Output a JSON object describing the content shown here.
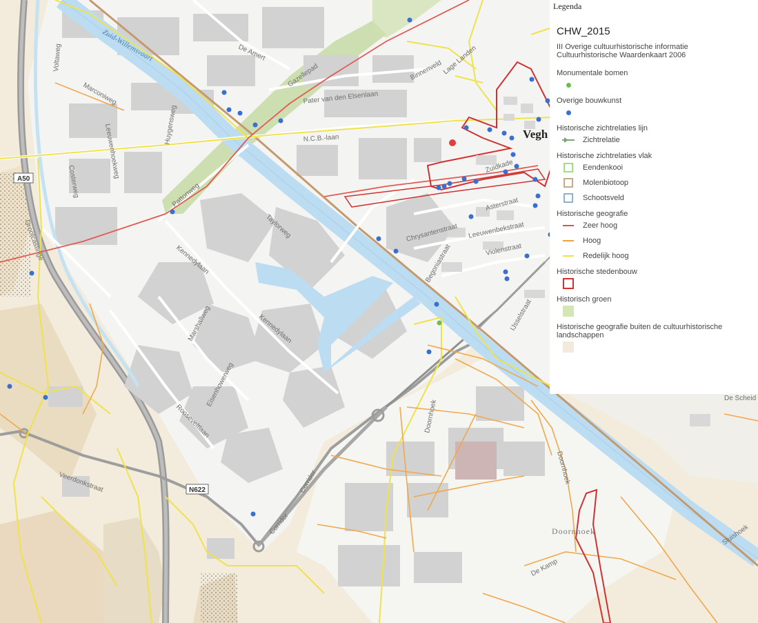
{
  "map": {
    "streets": [
      {
        "name": "Zuid-Willemsvaart",
        "kind": "canal"
      },
      {
        "name": "De Amert"
      },
      {
        "name": "Gazellepad"
      },
      {
        "name": "Pater van den Elsenlaan"
      },
      {
        "name": "Binnenveld"
      },
      {
        "name": "Lage Landen"
      },
      {
        "name": "N.C.B.-laan"
      },
      {
        "name": "Voltaweg"
      },
      {
        "name": "Marconiweg"
      },
      {
        "name": "Huygensweg"
      },
      {
        "name": "Leeuwenhoekweg"
      },
      {
        "name": "Costerweg"
      },
      {
        "name": "Pattonweg"
      },
      {
        "name": "Taylorweg"
      },
      {
        "name": "Kennedylaan"
      },
      {
        "name": "Kennedylaan"
      },
      {
        "name": "Marshallweg"
      },
      {
        "name": "Eisenhowerweg"
      },
      {
        "name": "Rooseveltlaan"
      },
      {
        "name": "Grootcastinge"
      },
      {
        "name": "Veerdonkstraat"
      },
      {
        "name": "Corridor"
      },
      {
        "name": "Corridor"
      },
      {
        "name": "Doornhoek"
      },
      {
        "name": "Chrysantenstraat"
      },
      {
        "name": "Leeuwenbekstraat"
      },
      {
        "name": "Asterstraat"
      },
      {
        "name": "Violenstraat"
      },
      {
        "name": "Begoniastraat"
      },
      {
        "name": "Zuidkade"
      },
      {
        "name": "IJsselstraat"
      },
      {
        "name": "De Scheid"
      },
      {
        "name": "Sluishoek"
      },
      {
        "name": "De Kamp"
      },
      {
        "name": "Doornhoek"
      }
    ],
    "place_doornhoek": "Doornhoek",
    "town": "Vegh",
    "shields": {
      "a50": "A50",
      "n622": "N622"
    }
  },
  "legend": {
    "title": "Legenda",
    "layer": "CHW_2015",
    "subtitle_1": "III Overige cultuurhistorische informatie",
    "subtitle_2": "Cultuurhistorische Waardenkaart 2006",
    "groups": {
      "monumentale_bomen": "Monumentale bomen",
      "overige_bouwkunst": "Overige bouwkunst",
      "zichtrelaties_lijn": "Historische zichtrelaties lijn",
      "zichtrelatie": "Zichtrelatie",
      "zichtrelaties_vlak": "Historische zichtrelaties vlak",
      "eendenkooi": "Eendenkooi",
      "molenbiotoop": "Molenbiotoop",
      "schootsveld": "Schootsveld",
      "geografie": "Historische geografie",
      "zeer_hoog": "Zeer hoog",
      "hoog": "Hoog",
      "redelijk_hoog": "Redelijk hoog",
      "stedenbouw": "Historische stedenbouw",
      "groen": "Historisch groen",
      "buiten": "Historische geografie buiten de cultuurhistorische landschappen"
    },
    "colors": {
      "bomen": "#6cc04a",
      "bouwkunst": "#3a6fd0",
      "zichtrelatie": "#7aa57a",
      "eendenkooi": "#9be37a",
      "molenbiotoop": "#c8a88a",
      "schootsveld": "#8fb0cf",
      "zeer_hoog": "#e0504a",
      "hoog": "#f0a040",
      "redelijk_hoog": "#f0e040",
      "stedenbouw": "#d03030",
      "groen": "#d4e6b5",
      "buiten": "#f3e9dc"
    }
  }
}
